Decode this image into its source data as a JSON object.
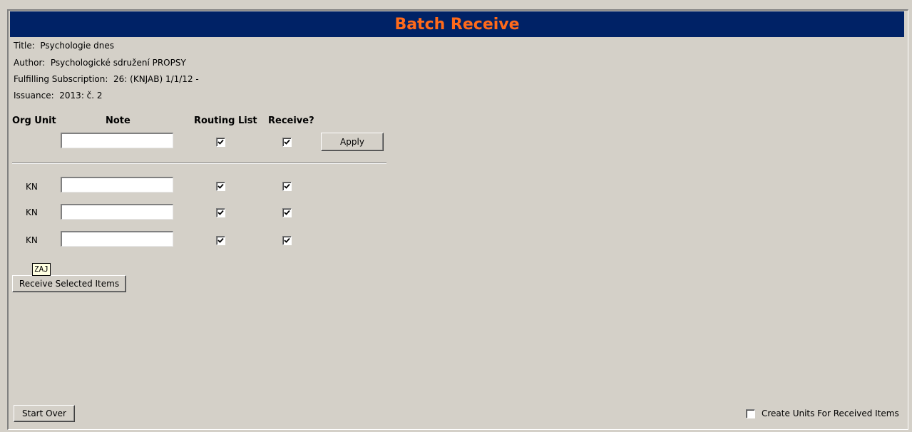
{
  "header": {
    "title": "Batch Receive"
  },
  "info": {
    "title_label": "Title:",
    "title_value": "Psychologie dnes",
    "author_label": "Author:",
    "author_value": "Psychologické sdružení PROPSY",
    "subscription_label": "Fulfilling Subscription:",
    "subscription_value": "26: (KNJAB) 1/1/12 -",
    "issuance_label": "Issuance:",
    "issuance_value": "2013: č. 2"
  },
  "columns": {
    "org_unit": "Org Unit",
    "note": "Note",
    "routing_list": "Routing List",
    "receive": "Receive?"
  },
  "apply_row": {
    "note_value": "",
    "routing_checked": true,
    "receive_checked": true,
    "apply_label": "Apply"
  },
  "rows": [
    {
      "org_unit": "KN",
      "note": "",
      "routing_checked": true,
      "receive_checked": true
    },
    {
      "org_unit": "KN",
      "note": "",
      "routing_checked": true,
      "receive_checked": true
    },
    {
      "org_unit": "KN",
      "note": "",
      "routing_checked": true,
      "receive_checked": true
    }
  ],
  "tooltip": {
    "text": "ZAJ"
  },
  "buttons": {
    "receive_selected": "Receive Selected Items",
    "start_over": "Start Over"
  },
  "create_units": {
    "label": "Create Units For Received Items",
    "checked": false
  }
}
